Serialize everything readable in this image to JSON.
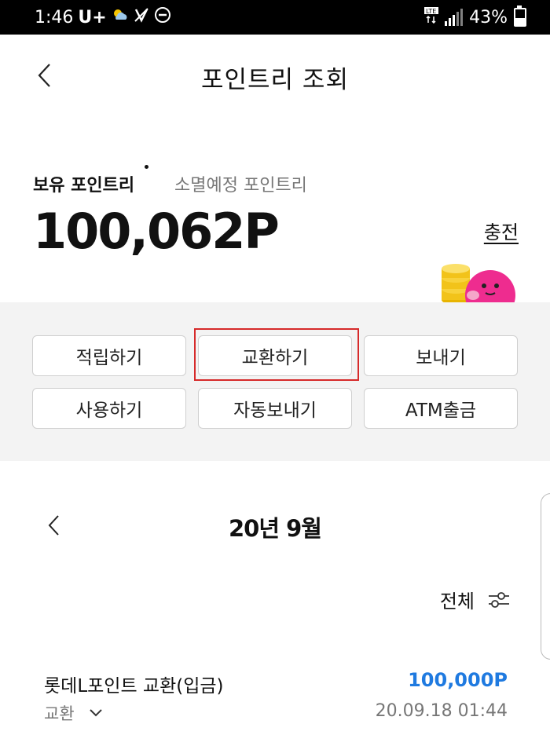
{
  "status_bar": {
    "time": "1:46",
    "carrier": "U+",
    "battery_percent": "43%",
    "icons": [
      "weather-icon",
      "vibrate-icon",
      "dnd-icon",
      "lte-icon",
      "signal-icon",
      "battery-icon"
    ]
  },
  "header": {
    "back_icon": "chevron-left-icon",
    "title": "포인트리 조회"
  },
  "points": {
    "tab_held": "보유 포인트리",
    "tab_expiring": "소멸예정 포인트리",
    "balance": "100,062P",
    "charge_label": "충전"
  },
  "actions": {
    "row1": [
      "적립하기",
      "교환하기",
      "보내기"
    ],
    "row2": [
      "사용하기",
      "자동보내기",
      "ATM출금"
    ],
    "highlighted": "교환하기"
  },
  "month_nav": {
    "title": "20년 9월"
  },
  "filter": {
    "label": "전체",
    "icon": "filter-sliders-icon"
  },
  "transactions": [
    {
      "title": "롯데L포인트 교환(입금)",
      "amount": "100,000P",
      "category": "교환",
      "datetime": "20.09.18 01:44"
    }
  ],
  "colors": {
    "amount_blue": "#1f7ae0",
    "highlight_red": "#d62a2a",
    "panel_bg": "#f3f3f3"
  }
}
